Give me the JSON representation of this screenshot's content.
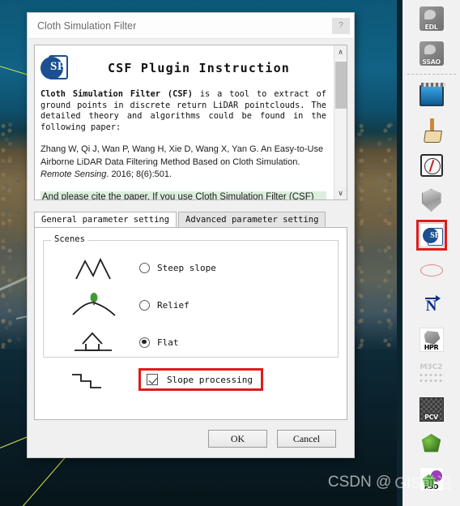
{
  "dialog": {
    "title": "Cloth Simulation Filter",
    "help_button": "?",
    "instruction": {
      "logo_text": "SF",
      "heading": "CSF Plugin Instruction",
      "body_bold": "Cloth Simulation Filter (CSF)",
      "body_rest": " is a tool to extract of ground points in discrete return LiDAR pointclouds. The detailed theory and algorithms could be found in the following paper:",
      "citation_main": "Zhang W, Qi J, Wan P, Wang H, Xie D, Wang X, Yan G. An Easy-to-Use Airborne LiDAR Data Filtering Method Based on Cloth Simulation. ",
      "citation_journal": "Remote Sensing",
      "citation_tail": ". 2016; 8(6):501.",
      "cite_note": "And please cite the paper, If you use Cloth Simulation Filter (CSF)",
      "scroll_up": "∧",
      "scroll_down": "∨"
    },
    "tabs": [
      {
        "label": "General parameter setting",
        "active": true
      },
      {
        "label": "Advanced parameter setting",
        "active": false
      }
    ],
    "scenes": {
      "legend": "Scenes",
      "options": [
        {
          "label": "Steep slope",
          "selected": false,
          "thumb": "steep-slope-thumb"
        },
        {
          "label": "Relief",
          "selected": false,
          "thumb": "relief-thumb"
        },
        {
          "label": "Flat",
          "selected": true,
          "thumb": "flat-house-thumb"
        }
      ]
    },
    "slope_processing": {
      "label": "Slope processing",
      "checked": true,
      "thumb": "step-slope-thumb",
      "highlight_color": "#e01b1b"
    },
    "buttons": {
      "ok": "OK",
      "cancel": "Cancel"
    }
  },
  "toolbar": {
    "items": [
      {
        "name": "edl-tool",
        "label": "EDL"
      },
      {
        "name": "ssao-tool",
        "label": "SSAO"
      },
      {
        "name": "animation-tool",
        "label": ""
      },
      {
        "name": "brush-tool",
        "label": ""
      },
      {
        "name": "compass-tool",
        "label": ""
      },
      {
        "name": "shield-tool",
        "label": ""
      },
      {
        "name": "csf-tool",
        "label": "SF",
        "highlighted": true
      },
      {
        "name": "ellipse-tool",
        "label": ""
      },
      {
        "name": "north-tool",
        "label": "N"
      },
      {
        "name": "hpr-tool",
        "label": "HPR"
      },
      {
        "name": "m3c2-tool",
        "label": "M3C2",
        "disabled": true
      },
      {
        "name": "pcv-tool",
        "label": "PCV"
      },
      {
        "name": "polyhedron-tool",
        "label": ""
      },
      {
        "name": "rsd-tool",
        "label": "RSD"
      }
    ]
  },
  "watermark": {
    "prefix": "CSDN @",
    "handle": "GIS前沿"
  },
  "colors": {
    "accent_red": "#e01b1b",
    "logo_blue": "#1b4f8f",
    "highlight_green": "#ddeedd",
    "background_navy": "#0b1b24"
  }
}
